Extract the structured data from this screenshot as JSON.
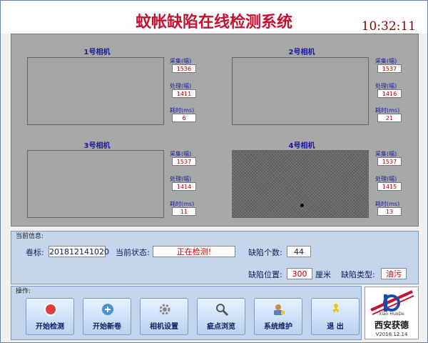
{
  "window": {
    "title": "蚊帐缺陷在线检测系统",
    "clock": "10:32:11"
  },
  "labels": {
    "collect": "采集(幅)",
    "process": "处理(幅)",
    "time": "耗时(ms)"
  },
  "cameras": [
    {
      "title": "1号相机",
      "collect": "1536",
      "process": "1411",
      "time": "6"
    },
    {
      "title": "2号相机",
      "collect": "1537",
      "process": "1416",
      "time": "21"
    },
    {
      "title": "3号相机",
      "collect": "1537",
      "process": "1414",
      "time": "11"
    },
    {
      "title": "4号相机",
      "collect": "1537",
      "process": "1415",
      "time": "13"
    }
  ],
  "info": {
    "group_label": "当前信息:",
    "roll_label": "卷标:",
    "roll_value": "201812141020",
    "status_label": "当前状态:",
    "status_value": "正在检测!",
    "count_label": "缺陷个数:",
    "count_value": "44",
    "pos_label": "缺陷位置:",
    "pos_value": "300",
    "pos_unit": "厘米",
    "type_label": "缺陷类型:",
    "type_value": "油污"
  },
  "ops": {
    "group_label": "操作:",
    "buttons": [
      "开始检测",
      "开始新卷",
      "相机设置",
      "疵点浏览",
      "系统维护",
      "退 出"
    ]
  },
  "logo": {
    "latin": "Xian HuoDe",
    "name": "西安获德",
    "version": "V2018.12.14"
  },
  "colors": {
    "title": "#c8102e",
    "label": "#1a1aa0",
    "value": "#b00000",
    "panel": "#c4d6ec"
  }
}
